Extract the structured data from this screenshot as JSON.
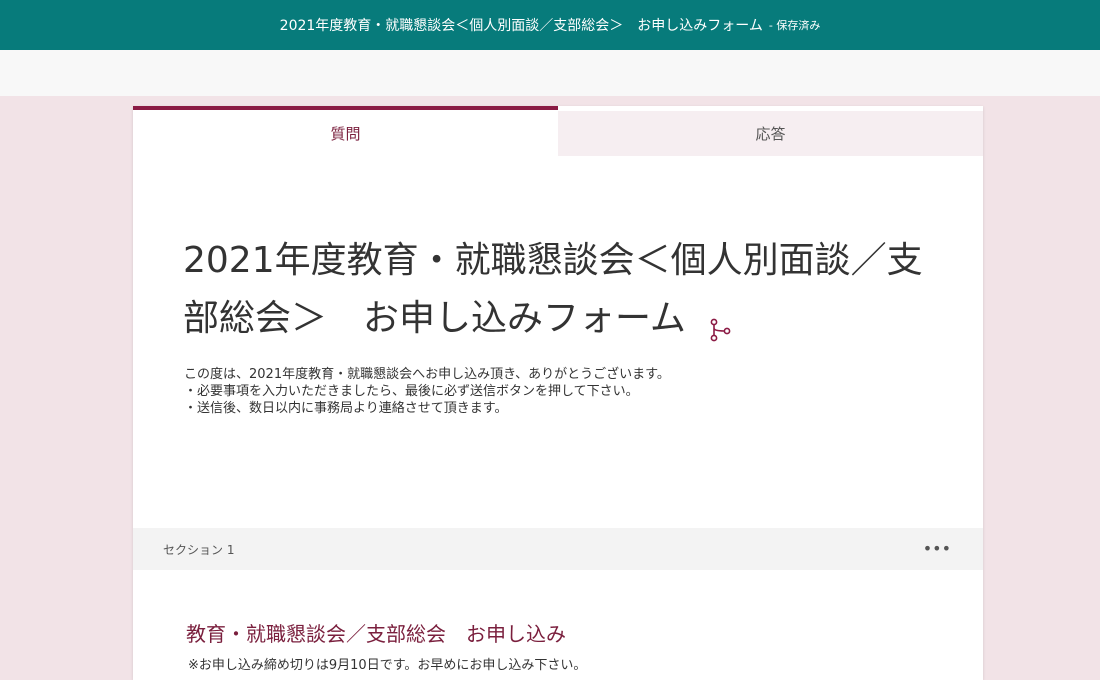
{
  "header": {
    "title": "2021年度教育・就職懇談会＜個人別面談／支部総会＞　お申し込みフォーム",
    "status": "- 保存済み"
  },
  "tabs": [
    {
      "label": "質問",
      "active": true
    },
    {
      "label": "応答",
      "active": false
    }
  ],
  "form": {
    "title": "2021年度教育・就職懇談会＜個人別面談／支部総会＞　お申し込みフォーム",
    "branch_icon": "branch-icon",
    "description_lines": [
      "この度は、2021年度教育・就職懇談会へお申し込み頂き、ありがとうございます。",
      "・必要事項を入力いただきましたら、最後に必ず送信ボタンを押して下さい。",
      "・送信後、数日以内に事務局より連絡させて頂きます。"
    ]
  },
  "section": {
    "label": "セクション 1",
    "more_icon": "more-options-icon"
  },
  "question": {
    "title": "教育・就職懇談会／支部総会　お申し込み",
    "note_lines": [
      "※お申し込み締め切りは9月10日です。お早めにお申し込み下さい。"
    ]
  },
  "colors": {
    "header_bg": "#077b7b",
    "accent": "#8b1a44",
    "page_bg": "#f2e3e7"
  }
}
